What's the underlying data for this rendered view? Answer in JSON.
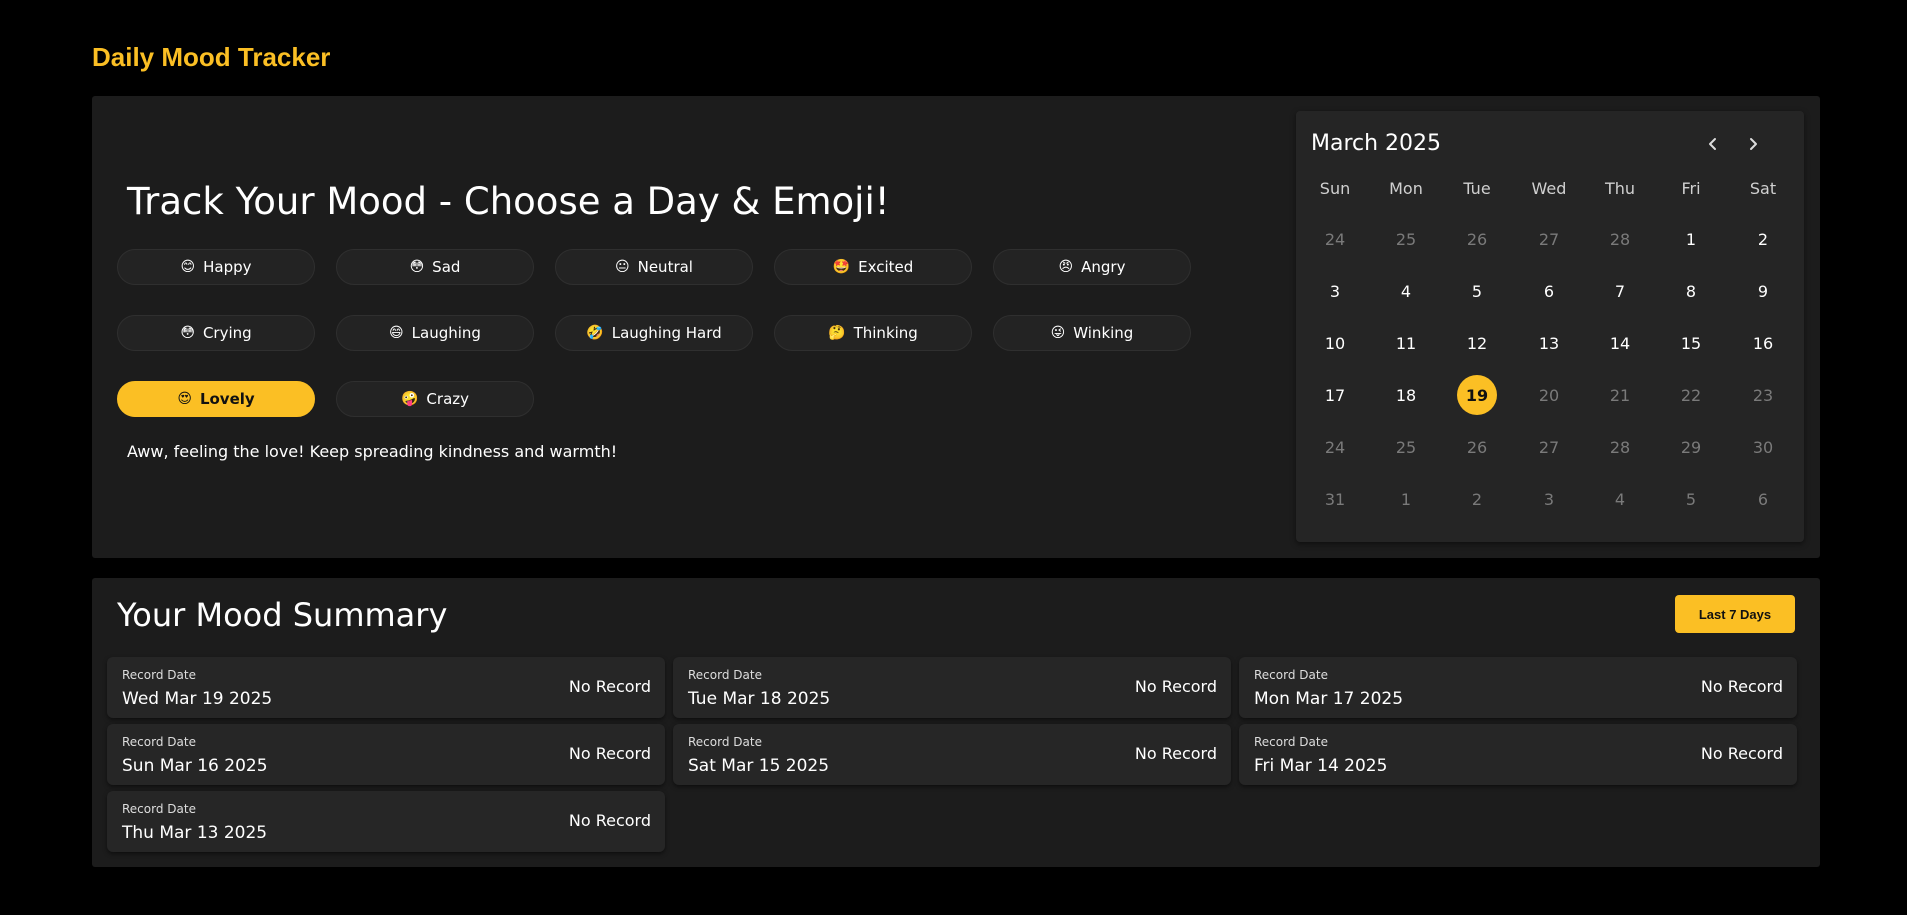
{
  "app_title": "Daily Mood Tracker",
  "heading": "Track Your Mood - Choose a Day & Emoji!",
  "moods": [
    {
      "emoji": "😊",
      "label": "Happy",
      "active": false
    },
    {
      "emoji": "😳",
      "label": "Sad",
      "active": false
    },
    {
      "emoji": "😐",
      "label": "Neutral",
      "active": false
    },
    {
      "emoji": "🤩",
      "label": "Excited",
      "active": false
    },
    {
      "emoji": "😠",
      "label": "Angry",
      "active": false
    },
    {
      "emoji": "😳",
      "label": "Crying",
      "active": false
    },
    {
      "emoji": "😄",
      "label": "Laughing",
      "active": false
    },
    {
      "emoji": "🤣",
      "label": "Laughing Hard",
      "active": false
    },
    {
      "emoji": "🤔",
      "label": "Thinking",
      "active": false
    },
    {
      "emoji": "😜",
      "label": "Winking",
      "active": false
    },
    {
      "emoji": "😍",
      "label": "Lovely",
      "active": true
    },
    {
      "emoji": "🤪",
      "label": "Crazy",
      "active": false
    }
  ],
  "message": "Aww, feeling the love! Keep spreading kindness and warmth!",
  "calendar": {
    "month_label": "March 2025",
    "weekdays": [
      "Sun",
      "Mon",
      "Tue",
      "Wed",
      "Thu",
      "Fri",
      "Sat"
    ],
    "weeks": [
      [
        {
          "d": "24",
          "muted": true
        },
        {
          "d": "25",
          "muted": true
        },
        {
          "d": "26",
          "muted": true
        },
        {
          "d": "27",
          "muted": true
        },
        {
          "d": "28",
          "muted": true
        },
        {
          "d": "1",
          "muted": false
        },
        {
          "d": "2",
          "muted": false
        }
      ],
      [
        {
          "d": "3",
          "muted": false
        },
        {
          "d": "4",
          "muted": false
        },
        {
          "d": "5",
          "muted": false
        },
        {
          "d": "6",
          "muted": false
        },
        {
          "d": "7",
          "muted": false
        },
        {
          "d": "8",
          "muted": false
        },
        {
          "d": "9",
          "muted": false
        }
      ],
      [
        {
          "d": "10",
          "muted": false
        },
        {
          "d": "11",
          "muted": false
        },
        {
          "d": "12",
          "muted": false
        },
        {
          "d": "13",
          "muted": false
        },
        {
          "d": "14",
          "muted": false
        },
        {
          "d": "15",
          "muted": false
        },
        {
          "d": "16",
          "muted": false
        }
      ],
      [
        {
          "d": "17",
          "muted": false
        },
        {
          "d": "18",
          "muted": false
        },
        {
          "d": "19",
          "muted": false,
          "selected": true
        },
        {
          "d": "20",
          "muted": true
        },
        {
          "d": "21",
          "muted": true
        },
        {
          "d": "22",
          "muted": true
        },
        {
          "d": "23",
          "muted": true
        }
      ],
      [
        {
          "d": "24",
          "muted": true
        },
        {
          "d": "25",
          "muted": true
        },
        {
          "d": "26",
          "muted": true
        },
        {
          "d": "27",
          "muted": true
        },
        {
          "d": "28",
          "muted": true
        },
        {
          "d": "29",
          "muted": true
        },
        {
          "d": "30",
          "muted": true
        }
      ],
      [
        {
          "d": "31",
          "muted": true
        },
        {
          "d": "1",
          "muted": true
        },
        {
          "d": "2",
          "muted": true
        },
        {
          "d": "3",
          "muted": true
        },
        {
          "d": "4",
          "muted": true
        },
        {
          "d": "5",
          "muted": true
        },
        {
          "d": "6",
          "muted": true
        }
      ]
    ],
    "prev_icon": "chevron-left-icon",
    "next_icon": "chevron-right-icon"
  },
  "summary": {
    "title": "Your Mood Summary",
    "range_button": "Last 7 Days",
    "records": [
      {
        "label": "Record Date",
        "date": "Wed Mar 19 2025",
        "status": "No Record"
      },
      {
        "label": "Record Date",
        "date": "Tue Mar 18 2025",
        "status": "No Record"
      },
      {
        "label": "Record Date",
        "date": "Mon Mar 17 2025",
        "status": "No Record"
      },
      {
        "label": "Record Date",
        "date": "Sun Mar 16 2025",
        "status": "No Record"
      },
      {
        "label": "Record Date",
        "date": "Sat Mar 15 2025",
        "status": "No Record"
      },
      {
        "label": "Record Date",
        "date": "Fri Mar 14 2025",
        "status": "No Record"
      },
      {
        "label": "Record Date",
        "date": "Thu Mar 13 2025",
        "status": "No Record"
      }
    ]
  },
  "colors": {
    "accent": "#fbbf24",
    "panel": "#1c1c1c",
    "card": "#262626",
    "background": "#000000"
  }
}
